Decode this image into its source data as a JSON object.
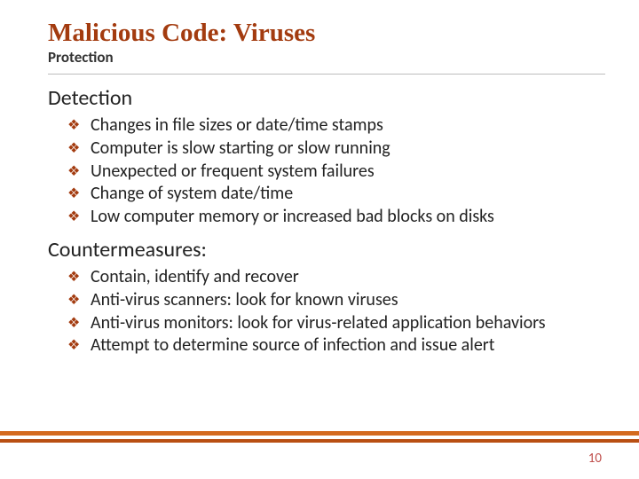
{
  "title": "Malicious Code: Viruses",
  "subtitle": "Protection",
  "sections": [
    {
      "heading": "Detection",
      "items": [
        "Changes in file sizes or date/time stamps",
        "Computer is slow starting or slow running",
        "Unexpected or frequent system failures",
        "Change of system date/time",
        "Low computer memory or increased bad blocks on disks"
      ]
    },
    {
      "heading": "Countermeasures:",
      "items": [
        "Contain, identify and recover",
        "Anti-virus scanners: look for known viruses",
        "Anti-virus monitors: look for virus-related application behaviors",
        "Attempt to determine source of infection and issue alert"
      ]
    }
  ],
  "bullet_glyph": "❖",
  "page_number": "10",
  "colors": {
    "accent": "#a33b0f",
    "footer": "#d46a1e"
  }
}
